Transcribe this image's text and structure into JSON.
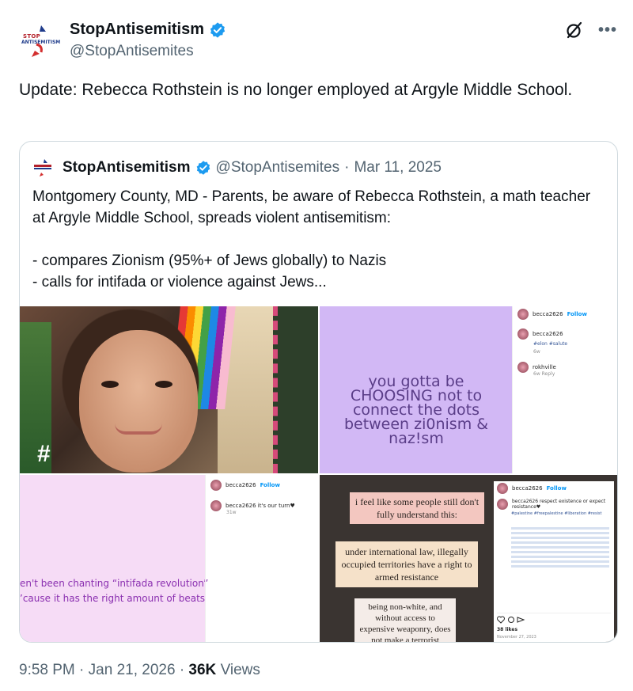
{
  "author": {
    "display_name": "StopAntisemitism",
    "handle": "@StopAntisemites",
    "avatar_text_top": "STOP",
    "avatar_text_bottom": "ANTISEMITISM"
  },
  "tweet": {
    "text": "Update: Rebecca Rothstein is no longer employed at Argyle Middle School."
  },
  "quoted": {
    "display_name": "StopAntisemitism",
    "handle": "@StopAntisemites",
    "separator": "·",
    "date": "Mar 11, 2025",
    "text": "Montgomery County, MD - Parents, be aware of Rebecca Rothstein, a math teacher at Argyle Middle School, spreads violent antisemitism:\n\n- compares Zionism (95%+ of Jews globally) to Nazis\n- calls for intifada or violence against Jews..."
  },
  "media": {
    "tile1": {
      "overlay": "#"
    },
    "tile2": {
      "quote": "you gotta be CHOOSING not to connect the dots between zi0nism & naz!sm",
      "user": "becca2626",
      "follow": "Follow",
      "comment_user": "becca2626",
      "comment_tags": "#elon #salute",
      "comment_time": "6w",
      "reply_user": "rokhville",
      "reply_meta": "6w  Reply"
    },
    "tile3": {
      "text": "en't been chanting “intifada revolution”\n’cause it has the right amount of beats",
      "user": "becca2626",
      "follow": "Follow",
      "comment": "becca2626 it's our turn♥",
      "time": "31w"
    },
    "tile4": {
      "note1": "i feel like some people still don't fully understand this:",
      "note2": "under international law, illegally occupied territories have a right to armed resistance",
      "note3": "being non-white, and without access to expensive weaponry, does not make a terrorist",
      "user": "becca2626",
      "follow": "Follow",
      "caption": "becca2626 respect existence or expect resistance♥",
      "tags": "#palestine #freepalestine #liberation #resist",
      "likes": "38 likes",
      "date": "November 27, 2023"
    }
  },
  "footer": {
    "time": "9:58 PM",
    "separator": "·",
    "date": "Jan 21, 2026",
    "views_count": "36K",
    "views_label": "Views"
  },
  "icons": {
    "verified": "verified-badge-icon",
    "grok": "grok-icon",
    "more": "more-icon"
  },
  "colors": {
    "verified_blue": "#1d9bf0",
    "muted_text": "#536471",
    "border": "#cfd9de"
  }
}
